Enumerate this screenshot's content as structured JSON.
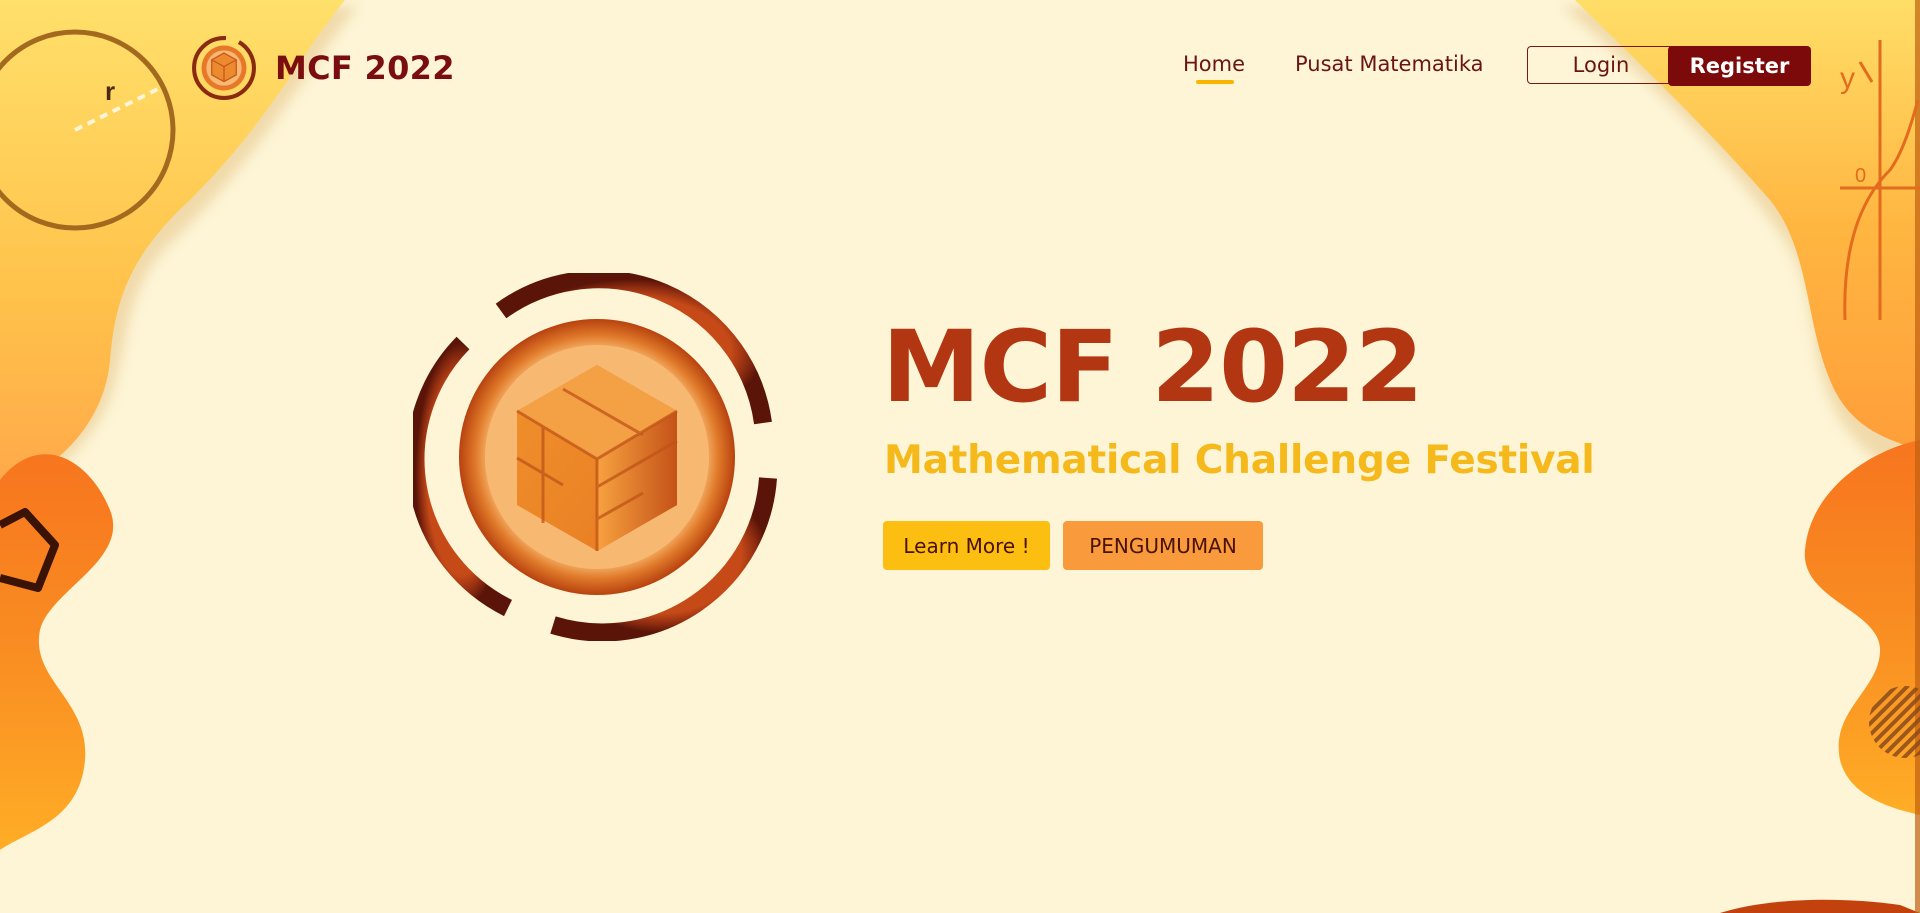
{
  "colors": {
    "background": "#fdf5d6",
    "brand_dark_red": "#7a0d0d",
    "title_orange_red": "#b33612",
    "subtitle_yellow": "#f5b91c",
    "learn_button": "#fcbe10",
    "pengumuman_button": "#f99b3c",
    "register_button": "#7c0a0a"
  },
  "brand": {
    "logo_icon": "mcf-cube-logo-icon",
    "name": "MCF 2022"
  },
  "nav": {
    "home": "Home",
    "pusat": "Pusat Matematika",
    "login": "Login",
    "register": "Register",
    "active": "Home"
  },
  "hero": {
    "logo_icon": "mcf-cube-logo-icon",
    "title": "MCF 2022",
    "subtitle": "Mathematical Challenge Festival",
    "learn_more": "Learn More !",
    "pengumuman": "PENGUMUMAN"
  },
  "decorations": {
    "radius_label": "r",
    "y_axis_label": "y",
    "origin_label": "0",
    "icons": [
      "circle-radius-icon",
      "pentagon-icon",
      "graph-axes-icon",
      "striped-circle-icon"
    ]
  }
}
